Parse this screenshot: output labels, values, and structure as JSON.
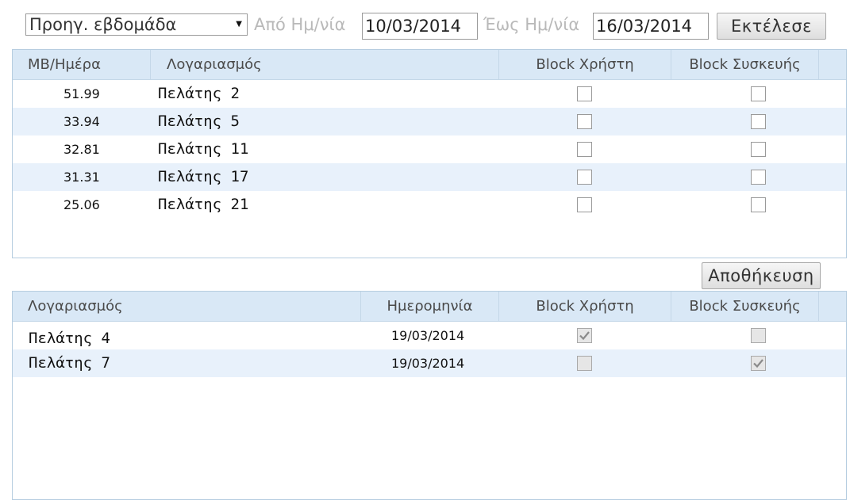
{
  "filter": {
    "period_value": "Προηγ. εβδομάδα",
    "from_label": "Από Ημ/νία",
    "from_value": "10/03/2014",
    "to_label": "Έως Ημ/νία",
    "to_value": "16/03/2014",
    "execute_label": "Εκτέλεσε"
  },
  "top_grid": {
    "headers": {
      "mb_per_day": "MB/Ημέρα",
      "account": "Λογαριασμός",
      "block_user": "Block Χρήστη",
      "block_device": "Block Συσκευής"
    },
    "rows": [
      {
        "mb": "51.99",
        "account": "Πελάτης 2",
        "block_user": false,
        "block_device": false
      },
      {
        "mb": "33.94",
        "account": "Πελάτης 5",
        "block_user": false,
        "block_device": false
      },
      {
        "mb": "32.81",
        "account": "Πελάτης 11",
        "block_user": false,
        "block_device": false
      },
      {
        "mb": "31.31",
        "account": "Πελάτης 17",
        "block_user": false,
        "block_device": false
      },
      {
        "mb": "25.06",
        "account": "Πελάτης 21",
        "block_user": false,
        "block_device": false
      }
    ]
  },
  "save_label": "Αποθήκευση",
  "bottom_grid": {
    "headers": {
      "account": "Λογαριασμός",
      "date": "Ημερομηνία",
      "block_user": "Block Χρήστη",
      "block_device": "Block Συσκευής"
    },
    "rows": [
      {
        "account": "Πελάτης 4",
        "date": "19/03/2014",
        "block_user": true,
        "block_device": false
      },
      {
        "account": "Πελάτης 7",
        "date": "19/03/2014",
        "block_user": false,
        "block_device": true
      }
    ]
  },
  "colors": {
    "header_bg": "#d9e8f6",
    "alt_row_bg": "#e8f1fb",
    "grid_border": "#b6cde0",
    "muted_label": "#b9b9b9"
  }
}
